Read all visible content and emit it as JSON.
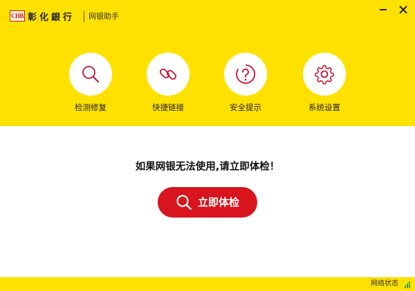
{
  "titlebar": {
    "logo_abbr": "CHB",
    "logo_text": "彰化銀行",
    "app_name": "网银助手"
  },
  "features": [
    {
      "label": "检测修复",
      "icon": "search-icon"
    },
    {
      "label": "快捷链接",
      "icon": "link-icon"
    },
    {
      "label": "安全提示",
      "icon": "help-icon"
    },
    {
      "label": "系统设置",
      "icon": "gear-icon"
    }
  ],
  "main": {
    "prompt": "如果网银无法使用,请立即体检！",
    "check_button": "立即体检"
  },
  "statusbar": {
    "network_status": "网络状态"
  },
  "colors": {
    "brand_yellow": "#ffe100",
    "accent_red": "#d8141c",
    "icon_red": "#c8102e",
    "signal_green": "#3aa63a"
  }
}
